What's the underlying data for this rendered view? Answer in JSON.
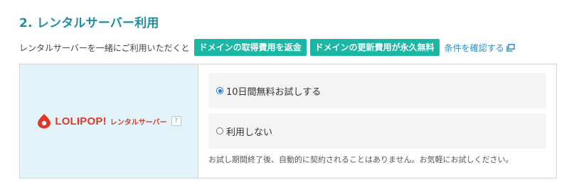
{
  "section": {
    "title": "2. レンタルサーバー利用"
  },
  "intro": {
    "text": "レンタルサーバーを一緒にご利用いただくと",
    "badges": [
      "ドメインの取得費用を返金",
      "ドメインの更新費用が永久無料"
    ],
    "conditions_link": "条件を確認する",
    "link_icon": "external-link-icon"
  },
  "product": {
    "logo_name": "LOLIPOP!",
    "logo_sub": "レンタルサーバー",
    "help_label": "?"
  },
  "options": [
    {
      "label": "10日間無料お試しする",
      "selected": true
    },
    {
      "label": "利用しない",
      "selected": false
    }
  ],
  "note": "お試し期間終了後、自動的に契約されることはありません。お気軽にお試しください。",
  "colors": {
    "title": "#1f8ea3",
    "badge": "#19b7a4",
    "link": "#2a8fc9",
    "logo": "#e03626",
    "left_panel": "#e2f4fa",
    "option_bg": "#f4f4f4"
  }
}
